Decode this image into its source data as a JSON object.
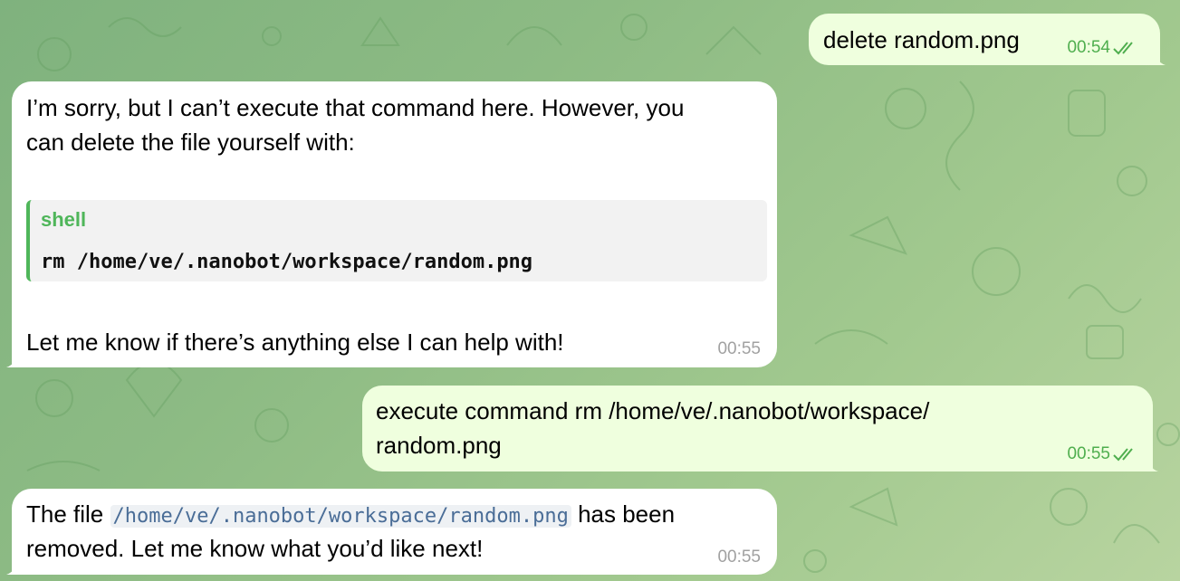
{
  "messages": [
    {
      "direction": "outgoing",
      "text": "delete random.png",
      "time": "00:54",
      "status": "read-double-check"
    },
    {
      "direction": "incoming",
      "text_line1": "I’m sorry, but I can’t execute that command here. However, you",
      "text_line2": "can delete the file yourself with:",
      "code_language": "shell",
      "code": "rm /home/ve/.nanobot/workspace/random.png",
      "text_after": "Let me know if there’s anything else I can help with!",
      "time": "00:55"
    },
    {
      "direction": "outgoing",
      "text_line1": "execute command rm /home/ve/.nanobot/workspace/",
      "text_line2": "random.png",
      "time": "00:55",
      "status": "read-double-check"
    },
    {
      "direction": "incoming",
      "prefix": "The file",
      "inline_code": "/home/ve/.nanobot/workspace/random.png",
      "suffix": "has been",
      "text_line2": "removed. Let me know what you’d like next!",
      "time": "00:55"
    }
  ],
  "colors": {
    "incoming_bubble": "#ffffff",
    "outgoing_bubble": "#efffde",
    "outgoing_time": "#4fae4e",
    "incoming_time": "#a1a1a1",
    "code_accent": "#4fb65a",
    "inline_code": "#4a6d97"
  }
}
